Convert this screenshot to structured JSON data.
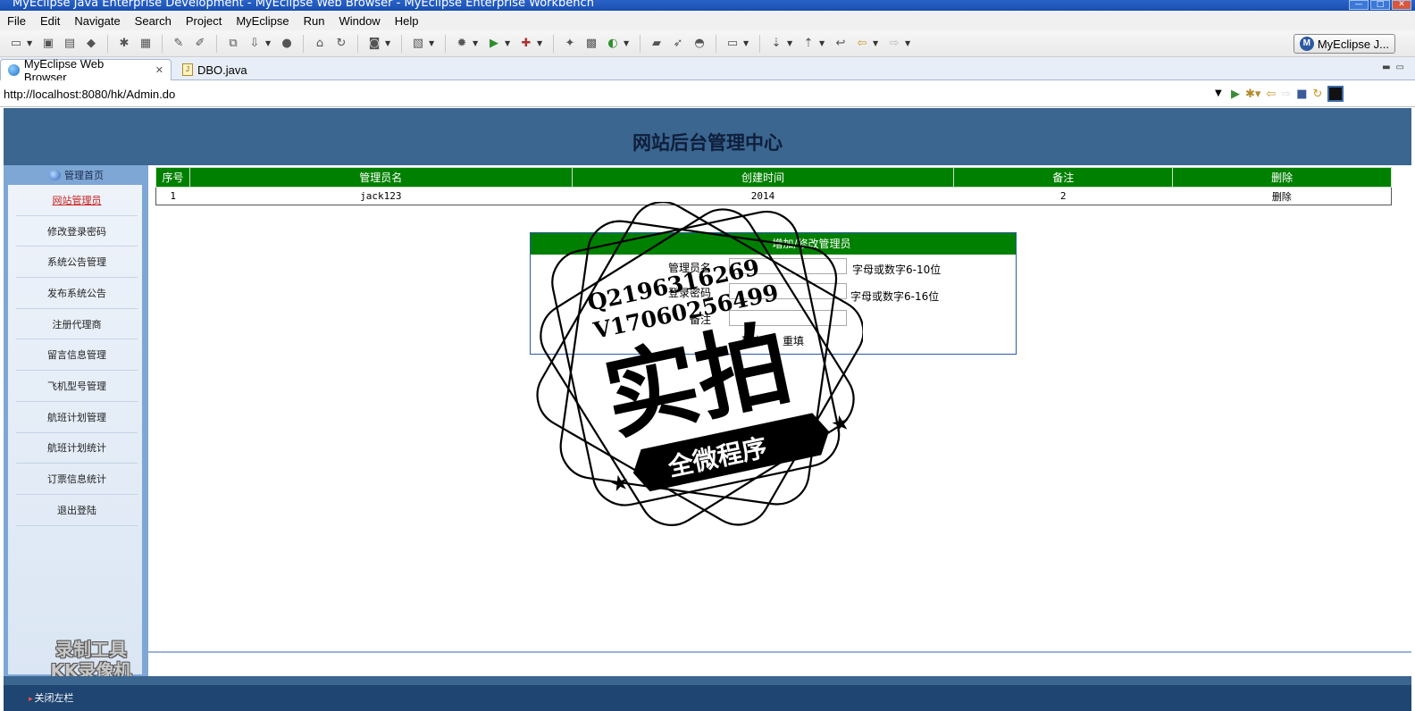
{
  "window": {
    "title": "MyEclipse Java Enterprise Development - MyEclipse Web Browser - MyEclipse Enterprise Workbench"
  },
  "menu": [
    "File",
    "Edit",
    "Navigate",
    "Search",
    "Project",
    "MyEclipse",
    "Run",
    "Window",
    "Help"
  ],
  "toolbar": {
    "perspective_label": "MyEclipse J..."
  },
  "tabs": [
    {
      "label": "MyEclipse Web Browser",
      "active": true
    },
    {
      "label": "DBO.java",
      "active": false
    }
  ],
  "address": {
    "url": "http://localhost:8080/hk/Admin.do"
  },
  "site": {
    "title": "网站后台管理中心",
    "home_label": "管理首页",
    "footer_label": "关闭左栏"
  },
  "sidebar": {
    "items": [
      {
        "label": "网站管理员",
        "active": true
      },
      {
        "label": "修改登录密码"
      },
      {
        "label": "系统公告管理"
      },
      {
        "label": "发布系统公告"
      },
      {
        "label": "注册代理商"
      },
      {
        "label": "留言信息管理"
      },
      {
        "label": "飞机型号管理"
      },
      {
        "label": "航班计划管理"
      },
      {
        "label": "航班计划统计"
      },
      {
        "label": "订票信息统计"
      },
      {
        "label": "退出登陆"
      }
    ]
  },
  "table": {
    "headers": [
      "序号",
      "管理员名",
      "创建时间",
      "备注",
      "删除"
    ],
    "rows": [
      {
        "index": "1",
        "name": "jack123",
        "created": "2014",
        "note": "2",
        "action": "删除"
      }
    ]
  },
  "form": {
    "title": "增加/修改管理员",
    "username_label": "管理员名",
    "username_hint": "字母或数字6-10位",
    "password_label": "登录密码",
    "password_hint": "字母或数字6-16位",
    "note_label": "备注",
    "submit_label": "确定",
    "reset_label": "重填"
  },
  "watermarks": {
    "recorder_line1": "录制工具",
    "recorder_line2": "KK录像机",
    "stamp_line1": "Q2196316269",
    "stamp_line2": "V17060256499",
    "stamp_main": "实拍",
    "stamp_banner": "全微程序"
  }
}
